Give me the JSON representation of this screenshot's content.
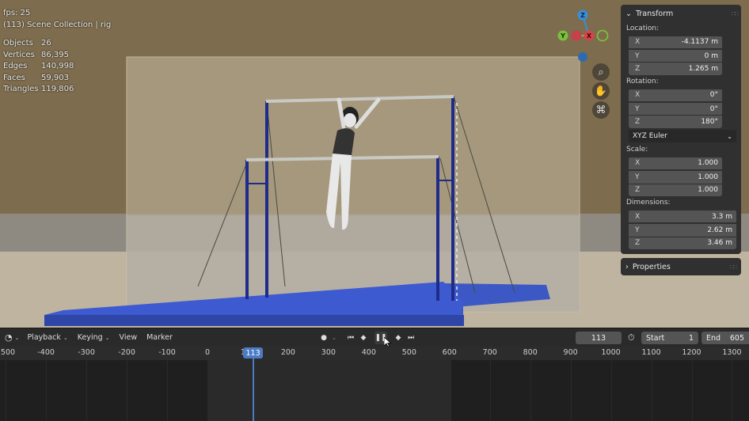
{
  "viewport": {
    "stats": {
      "fps": "fps: 25",
      "collection": "(113) Scene Collection | rig",
      "rows": [
        {
          "label": "Objects",
          "value": "26"
        },
        {
          "label": "Vertices",
          "value": "86,395"
        },
        {
          "label": "Edges",
          "value": "140,998"
        },
        {
          "label": "Faces",
          "value": "59,903"
        },
        {
          "label": "Triangles",
          "value": "119,806"
        }
      ]
    },
    "gizmo": {
      "y": "Y",
      "x": "X",
      "z": "Z"
    }
  },
  "transform_panel": {
    "title": "Transform",
    "location": {
      "label": "Location:",
      "x": "-4.1137 m",
      "y": "0 m",
      "z": "1.265 m"
    },
    "rotation": {
      "label": "Rotation:",
      "x": "0°",
      "y": "0°",
      "z": "180°",
      "mode": "XYZ Euler"
    },
    "scale": {
      "label": "Scale:",
      "x": "1.000",
      "y": "1.000",
      "z": "1.000"
    },
    "dimensions": {
      "label": "Dimensions:",
      "x": "3.3 m",
      "y": "2.62 m",
      "z": "3.46 m"
    },
    "axis_labels": {
      "x": "X",
      "y": "Y",
      "z": "Z"
    }
  },
  "properties_panel": {
    "title": "Properties"
  },
  "timeline": {
    "menus": {
      "playback": "Playback",
      "keying": "Keying",
      "view": "View",
      "marker": "Marker"
    },
    "current_frame": "113",
    "start_label": "Start",
    "start_value": "1",
    "end_label": "End",
    "end_value": "605",
    "ruler_ticks": [
      "500",
      "-400",
      "-300",
      "-200",
      "-100",
      "0",
      "100",
      "200",
      "300",
      "400",
      "500",
      "600",
      "700",
      "800",
      "900",
      "1000",
      "1100",
      "1200",
      "1300"
    ],
    "playhead_frame": 113,
    "range_start": 1,
    "range_end": 605
  },
  "colors": {
    "accent": "#4c7bc4",
    "axis_x": "#d9434b",
    "axis_y": "#7cbf3a",
    "axis_z": "#3a8fd9"
  }
}
